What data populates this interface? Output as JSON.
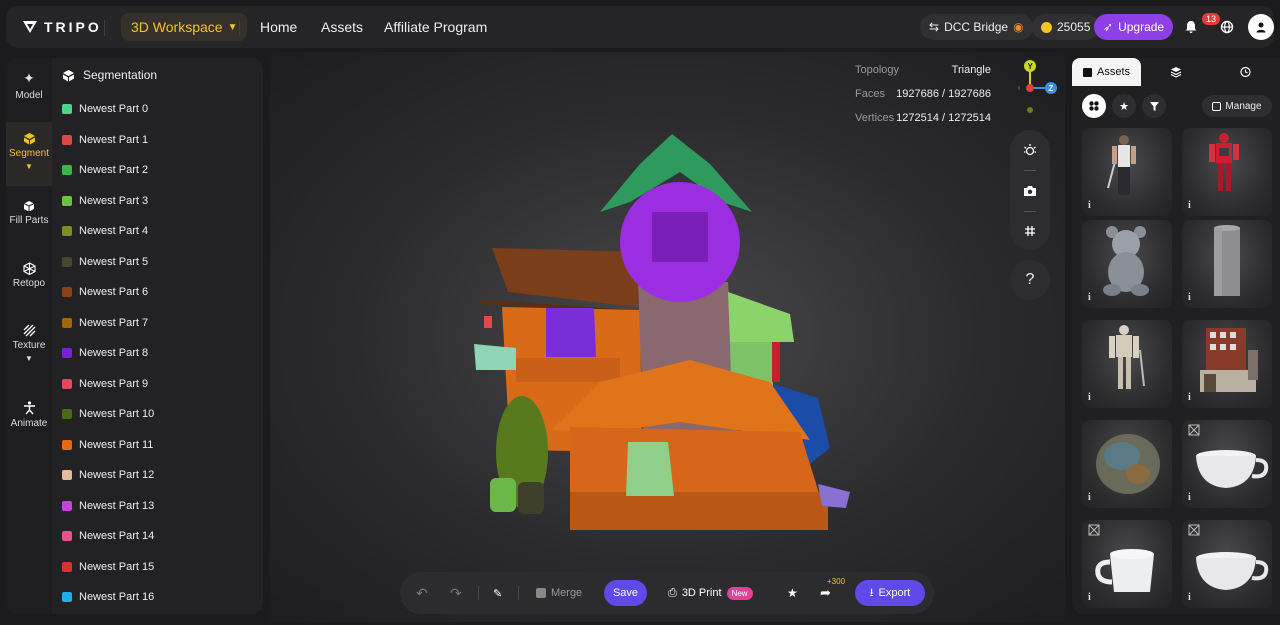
{
  "topbar": {
    "logo_text": "TRIPO",
    "workspace_label": "3D Workspace",
    "nav": [
      "Home",
      "Assets",
      "Affiliate Program"
    ],
    "dcc_bridge_label": "DCC Bridge",
    "credits": "25055",
    "upgrade_label": "Upgrade",
    "notification_count": "13",
    "accent_color": "#f4c325",
    "primary_color": "#5f49e8"
  },
  "toolrail": {
    "tools": [
      {
        "label": "Model",
        "icon": "sparkle-icon"
      },
      {
        "label": "Segment",
        "icon": "cube-split-icon",
        "active": true
      },
      {
        "label": "Fill Parts",
        "icon": "cube-icon"
      },
      {
        "label": "Retopo",
        "icon": "mesh-icon"
      },
      {
        "label": "Texture",
        "icon": "texture-icon"
      },
      {
        "label": "Animate",
        "icon": "figure-icon"
      }
    ]
  },
  "segmentation": {
    "title": "Segmentation",
    "parts": [
      {
        "label": "Newest Part 0",
        "color": "#4bd48a"
      },
      {
        "label": "Newest Part 1",
        "color": "#e04848"
      },
      {
        "label": "Newest Part 2",
        "color": "#35b84a"
      },
      {
        "label": "Newest Part 3",
        "color": "#6cc43e"
      },
      {
        "label": "Newest Part 4",
        "color": "#7d8f24"
      },
      {
        "label": "Newest Part 5",
        "color": "#47472e"
      },
      {
        "label": "Newest Part 6",
        "color": "#8a3f14"
      },
      {
        "label": "Newest Part 7",
        "color": "#a46410"
      },
      {
        "label": "Newest Part 8",
        "color": "#7a1fd8"
      },
      {
        "label": "Newest Part 9",
        "color": "#e8485e"
      },
      {
        "label": "Newest Part 10",
        "color": "#4b6a14"
      },
      {
        "label": "Newest Part 11",
        "color": "#e8690e"
      },
      {
        "label": "Newest Part 12",
        "color": "#e4bc9c"
      },
      {
        "label": "Newest Part 13",
        "color": "#c844e0"
      },
      {
        "label": "Newest Part 14",
        "color": "#e8508e"
      },
      {
        "label": "Newest Part 15",
        "color": "#d8332e"
      },
      {
        "label": "Newest Part 16",
        "color": "#1eaee8"
      }
    ]
  },
  "stats": {
    "topology_label": "Topology",
    "topology_value": "Triangle",
    "faces_label": "Faces",
    "faces_value": "1927686 / 1927686",
    "vertices_label": "Vertices",
    "vertices_value": "1272514 / 1272514"
  },
  "axes": {
    "y": "Y",
    "z": "Z"
  },
  "help_label": "?",
  "bottombar": {
    "merge_label": "Merge",
    "save_label": "Save",
    "print_label": "3D Print",
    "new_tag": "New",
    "share_bonus": "+300",
    "export_label": "Export"
  },
  "assets_panel": {
    "tabs": [
      "Assets",
      "",
      ""
    ],
    "manage_label": "Manage",
    "info_mark": "i",
    "cards": [
      {
        "subject": "warrior-with-sword"
      },
      {
        "subject": "red-robot"
      },
      {
        "subject": "teddy-bear"
      },
      {
        "subject": "cylinder"
      },
      {
        "subject": "knight-armor"
      },
      {
        "subject": "building"
      },
      {
        "subject": "rock"
      },
      {
        "subject": "white-cup"
      },
      {
        "subject": "white-mug"
      },
      {
        "subject": "white-cup-2"
      }
    ]
  }
}
